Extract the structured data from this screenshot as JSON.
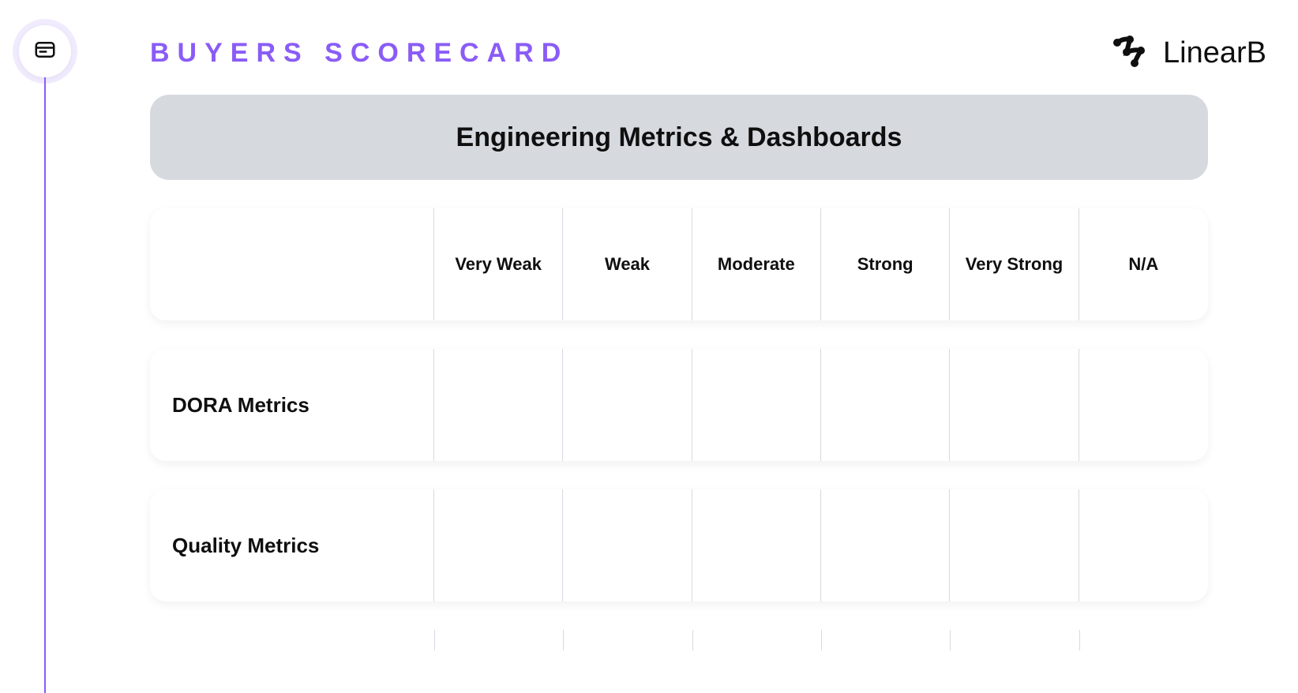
{
  "page_title": "BUYERS SCORECARD",
  "brand": {
    "name": "LinearB"
  },
  "section": {
    "title": "Engineering Metrics & Dashboards"
  },
  "columns": [
    "Very Weak",
    "Weak",
    "Moderate",
    "Strong",
    "Very Strong",
    "N/A"
  ],
  "rows": [
    {
      "label": "DORA Metrics"
    },
    {
      "label": "Quality Metrics"
    }
  ]
}
